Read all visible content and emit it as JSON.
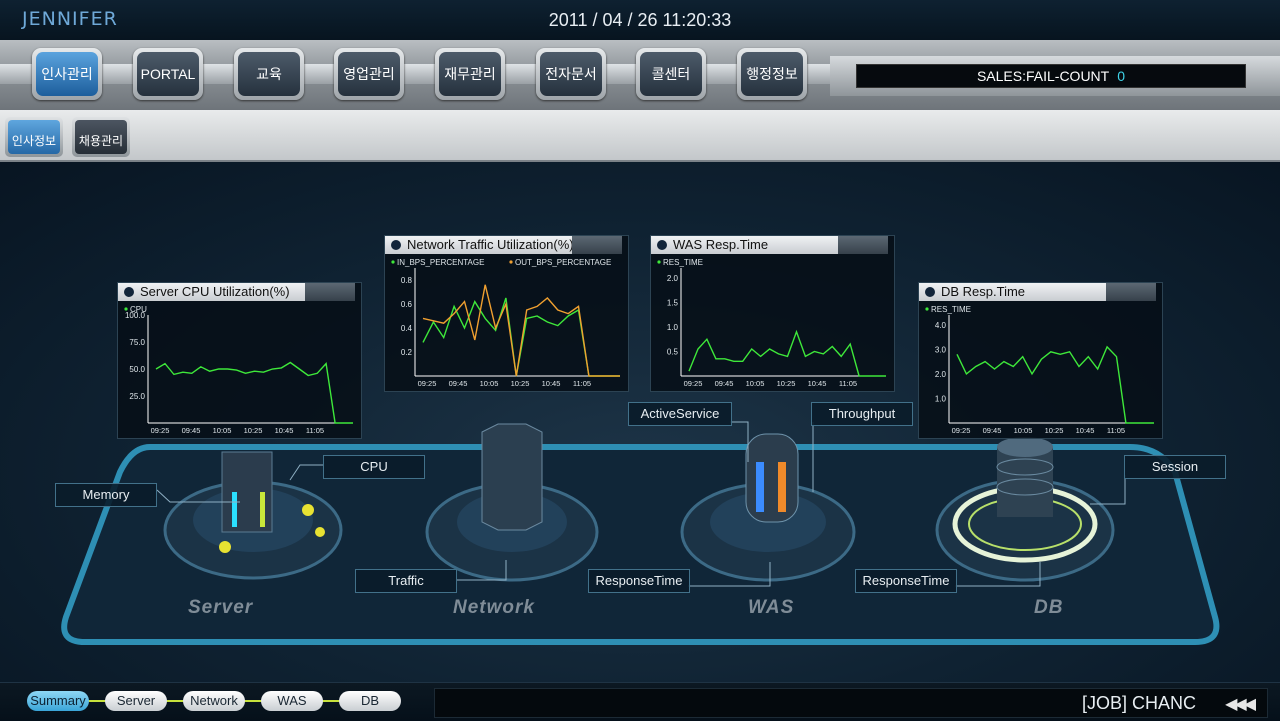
{
  "header": {
    "logo": "JENNIFER",
    "datetime": "2011 / 04 / 26 11:20:33"
  },
  "menu": {
    "items": [
      {
        "label": "인사관리",
        "active": true
      },
      {
        "label": "PORTAL",
        "active": false
      },
      {
        "label": "교육",
        "active": false
      },
      {
        "label": "영업관리",
        "active": false
      },
      {
        "label": "재무관리",
        "active": false
      },
      {
        "label": "전자문서",
        "active": false
      },
      {
        "label": "콜센터",
        "active": false
      },
      {
        "label": "행정정보",
        "active": false
      }
    ],
    "fail_label": "SALES:FAIL-COUNT",
    "fail_count": "0"
  },
  "submenu": {
    "items": [
      {
        "label": "인사정보",
        "active": true
      },
      {
        "label": "채용관리",
        "active": false
      }
    ]
  },
  "diagram": {
    "zones": [
      "Server",
      "Network",
      "WAS",
      "DB"
    ],
    "labels": {
      "memory": "Memory",
      "cpu": "CPU",
      "traffic": "Traffic",
      "active_service": "ActiveService",
      "throughput": "Throughput",
      "was_response_time": "ResponseTime",
      "db_response_time": "ResponseTime",
      "session": "Session"
    }
  },
  "chart_data": [
    {
      "type": "line",
      "title": "Server CPU Utilization(%)",
      "legend": [
        "CPU"
      ],
      "x": [
        "09:25",
        "09:45",
        "10:05",
        "10:25",
        "10:45",
        "11:05"
      ],
      "yticks": [
        "25.0",
        "50.0",
        "75.0",
        "100.0"
      ],
      "ylim": [
        0,
        100
      ],
      "series": [
        {
          "name": "CPU",
          "color": "#3ee83a",
          "values": [
            50,
            55,
            45,
            47,
            46,
            52,
            48,
            50,
            50,
            49,
            46,
            48,
            47,
            50,
            51,
            56,
            50,
            44,
            46,
            55,
            0,
            0,
            0
          ]
        }
      ]
    },
    {
      "type": "line",
      "title": "Network Traffic Utilization(%)",
      "legend": [
        "IN_BPS_PERCENTAGE",
        "OUT_BPS_PERCENTAGE"
      ],
      "x": [
        "09:25",
        "09:45",
        "10:05",
        "10:25",
        "10:45",
        "11:05"
      ],
      "yticks": [
        "0.2",
        "0.4",
        "0.6",
        "0.8"
      ],
      "ylim": [
        0,
        0.9
      ],
      "series": [
        {
          "name": "IN_BPS_PERCENTAGE",
          "color": "#3ee83a",
          "values": [
            0.28,
            0.45,
            0.32,
            0.58,
            0.4,
            0.62,
            0.48,
            0.38,
            0.65,
            0.0,
            0.48,
            0.5,
            0.45,
            0.42,
            0.5,
            0.55,
            0.0,
            0.0,
            0.0,
            0.0
          ]
        },
        {
          "name": "OUT_BPS_PERCENTAGE",
          "color": "#f0a030",
          "values": [
            0.48,
            0.46,
            0.44,
            0.52,
            0.62,
            0.3,
            0.76,
            0.4,
            0.6,
            0.0,
            0.55,
            0.58,
            0.65,
            0.55,
            0.52,
            0.58,
            0.0,
            0.0,
            0.0,
            0.0
          ]
        }
      ]
    },
    {
      "type": "line",
      "title": "WAS Resp.Time",
      "legend": [
        "RES_TIME"
      ],
      "x": [
        "09:25",
        "09:45",
        "10:05",
        "10:25",
        "10:45",
        "11:05"
      ],
      "yticks": [
        "0.5",
        "1.0",
        "1.5",
        "2.0"
      ],
      "ylim": [
        0,
        2.2
      ],
      "series": [
        {
          "name": "RES_TIME",
          "color": "#3ee83a",
          "values": [
            0.1,
            0.55,
            0.75,
            0.35,
            0.35,
            0.3,
            0.3,
            0.55,
            0.4,
            0.55,
            0.45,
            0.4,
            0.9,
            0.4,
            0.5,
            0.45,
            0.6,
            0.4,
            0.65,
            0.0,
            0.0,
            0.0,
            0.0
          ]
        }
      ]
    },
    {
      "type": "line",
      "title": "DB Resp.Time",
      "legend": [
        "RES_TIME"
      ],
      "x": [
        "09:25",
        "09:45",
        "10:05",
        "10:25",
        "10:45",
        "11:05"
      ],
      "yticks": [
        "1.0",
        "2.0",
        "3.0",
        "4.0"
      ],
      "ylim": [
        0,
        4.4
      ],
      "series": [
        {
          "name": "RES_TIME",
          "color": "#3ee83a",
          "values": [
            2.8,
            2.0,
            2.3,
            2.5,
            2.2,
            2.5,
            2.3,
            2.7,
            2.0,
            2.6,
            2.9,
            2.8,
            2.9,
            2.3,
            2.7,
            2.2,
            3.1,
            2.7,
            0.0,
            0.0,
            0.0,
            0.0
          ]
        }
      ]
    }
  ],
  "bottom_nav": {
    "items": [
      {
        "label": "Summary",
        "active": true
      },
      {
        "label": "Server",
        "active": false
      },
      {
        "label": "Network",
        "active": false
      },
      {
        "label": "WAS",
        "active": false
      },
      {
        "label": "DB",
        "active": false
      }
    ],
    "ticker": "[JOB] CHANC",
    "ticker_arrows": "◀◀◀"
  },
  "colors": {
    "accent": "#3aa5d8",
    "fail_count": "#3fd3e8",
    "series_green": "#3ee83a",
    "series_orange": "#f0a030"
  }
}
